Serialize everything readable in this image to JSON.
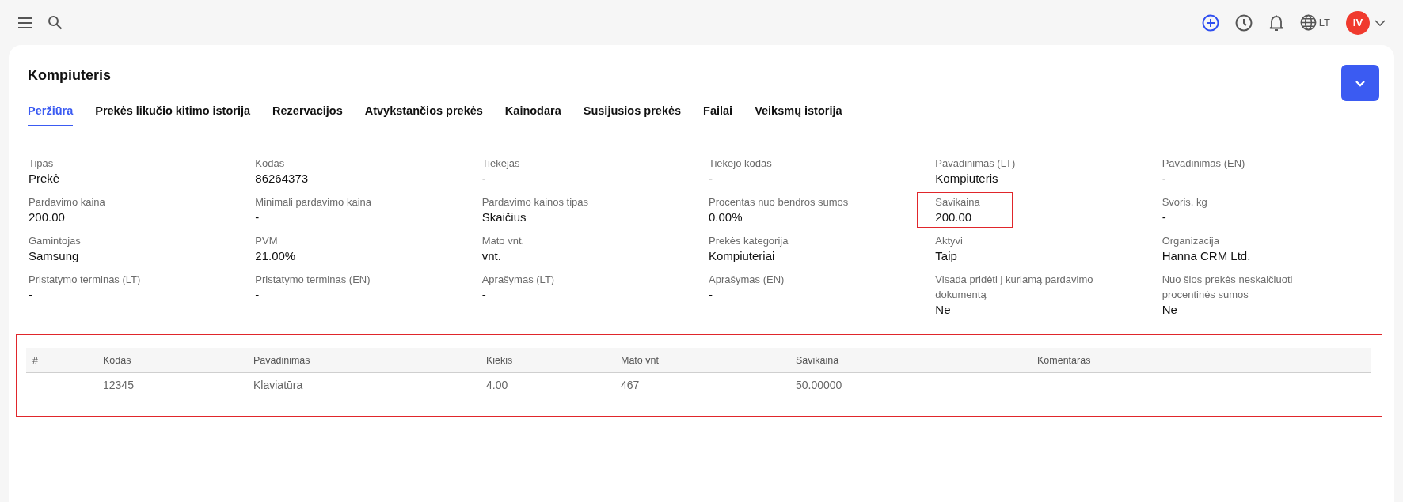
{
  "topbar": {
    "language": "LT",
    "avatar_initials": "IV"
  },
  "title": "Kompiuteris",
  "tabs": [
    {
      "label": "Peržiūra",
      "selected": true
    },
    {
      "label": "Prekės likučio kitimo istorija",
      "selected": false
    },
    {
      "label": "Rezervacijos",
      "selected": false
    },
    {
      "label": "Atvykstančios prekės",
      "selected": false
    },
    {
      "label": "Kainodara",
      "selected": false
    },
    {
      "label": "Susijusios prekės",
      "selected": false
    },
    {
      "label": "Failai",
      "selected": false
    },
    {
      "label": "Veiksmų istorija",
      "selected": false
    }
  ],
  "fields": [
    {
      "label": "Tipas",
      "value": "Prekė",
      "highlighted": false
    },
    {
      "label": "Kodas",
      "value": "86264373",
      "highlighted": false
    },
    {
      "label": "Tiekėjas",
      "value": "-",
      "highlighted": false
    },
    {
      "label": "Tiekėjo kodas",
      "value": "-",
      "highlighted": false
    },
    {
      "label": "Pavadinimas (LT)",
      "value": "Kompiuteris",
      "highlighted": false
    },
    {
      "label": "Pavadinimas (EN)",
      "value": "-",
      "highlighted": false
    },
    {
      "label": "Pardavimo kaina",
      "value": "200.00",
      "highlighted": false
    },
    {
      "label": "Minimali pardavimo kaina",
      "value": "-",
      "highlighted": false
    },
    {
      "label": "Pardavimo kainos tipas",
      "value": "Skaičius",
      "highlighted": false
    },
    {
      "label": "Procentas nuo bendros sumos",
      "value": "0.00%",
      "highlighted": false
    },
    {
      "label": "Savikaina",
      "value": "200.00",
      "highlighted": true
    },
    {
      "label": "Svoris, kg",
      "value": "-",
      "highlighted": false
    },
    {
      "label": "Gamintojas",
      "value": "Samsung",
      "highlighted": false
    },
    {
      "label": "PVM",
      "value": "21.00%",
      "highlighted": false
    },
    {
      "label": "Mato vnt.",
      "value": "vnt.",
      "highlighted": false
    },
    {
      "label": "Prekės kategorija",
      "value": "Kompiuteriai",
      "highlighted": false
    },
    {
      "label": "Aktyvi",
      "value": "Taip",
      "highlighted": false
    },
    {
      "label": "Organizacija",
      "value": "Hanna CRM Ltd.",
      "highlighted": false
    },
    {
      "label": "Pristatymo terminas (LT)",
      "value": "-",
      "highlighted": false
    },
    {
      "label": "Pristatymo terminas (EN)",
      "value": "-",
      "highlighted": false
    },
    {
      "label": "Aprašymas (LT)",
      "value": "-",
      "highlighted": false
    },
    {
      "label": "Aprašymas (EN)",
      "value": "-",
      "highlighted": false
    },
    {
      "label": "Visada pridėti į kuriamą pardavimo dokumentą",
      "value": "Ne",
      "highlighted": false
    },
    {
      "label": "Nuo šios prekės neskaičiuoti procentinės sumos",
      "value": "Ne",
      "highlighted": false
    }
  ],
  "table": {
    "highlighted": true,
    "columns": [
      "#",
      "Kodas",
      "Pavadinimas",
      "Kiekis",
      "Mato vnt",
      "Savikaina",
      "Komentaras"
    ],
    "rows": [
      {
        "cells": [
          null,
          "12345",
          "Klaviatūra",
          "4.00",
          "467",
          "50.00000",
          null
        ]
      }
    ]
  }
}
